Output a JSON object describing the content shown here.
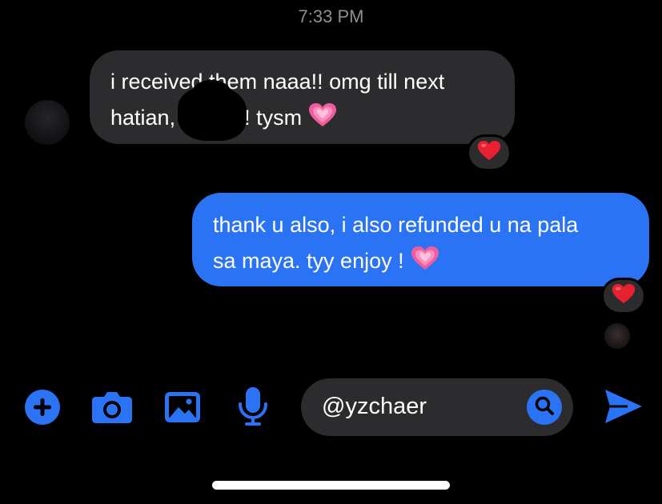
{
  "conversation": {
    "timestamp": "7:33 PM",
    "messages": [
      {
        "direction": "incoming",
        "lines": [
          "i received them naaa!! omg till next",
          "hatian,",
          "! tysm"
        ],
        "emoji": "heart-emoji",
        "reaction": "red-heart"
      },
      {
        "direction": "outgoing",
        "lines": [
          "thank u also, i also refunded u na pala",
          "sa maya. tyy enjoy !"
        ],
        "emoji": "heart-emoji",
        "reaction": "red-heart"
      }
    ]
  },
  "composer": {
    "input_value": "@yzchaer",
    "icons": [
      "plus-icon",
      "camera-icon",
      "gallery-icon",
      "microphone-icon",
      "search-icon",
      "send-icon"
    ]
  },
  "colors": {
    "background": "#000000",
    "incoming_bubble": "#2c2c2e",
    "outgoing_bubble": "#2b73f5",
    "accent": "#2b73f5",
    "timestamp_text": "#8e8e93"
  }
}
